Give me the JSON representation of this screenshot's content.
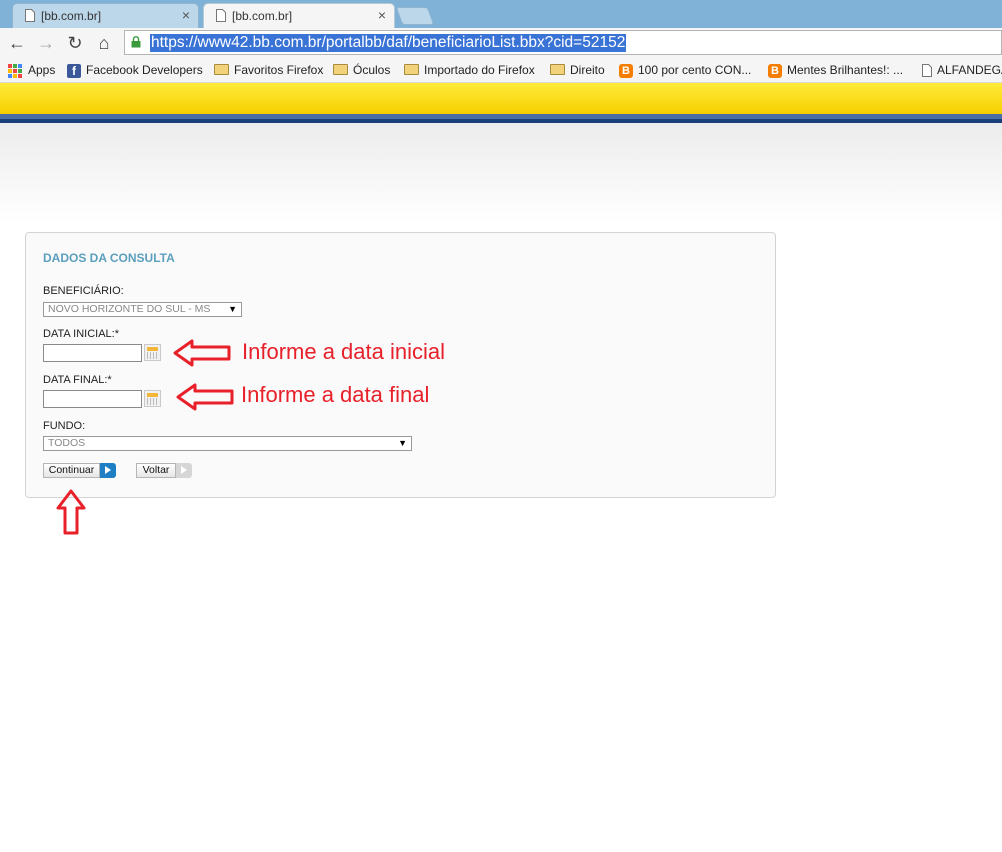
{
  "browser": {
    "tabs": [
      {
        "title": "[bb.com.br]",
        "close": "×",
        "active": false
      },
      {
        "title": "[bb.com.br]",
        "close": "×",
        "active": true
      }
    ],
    "url": "https://www42.bb.com.br/portalbb/daf/beneficiarioList.bbx?cid=52152",
    "nav": {
      "back": "←",
      "forward": "→",
      "reload": "↻",
      "home": "⌂"
    }
  },
  "bookmarks": [
    {
      "label": "Apps",
      "icon": "apps-grid-icon"
    },
    {
      "label": "Facebook Developers",
      "icon": "facebook-icon"
    },
    {
      "label": "Favoritos Firefox",
      "icon": "folder-icon"
    },
    {
      "label": "Óculos",
      "icon": "folder-icon"
    },
    {
      "label": "Importado do Firefox",
      "icon": "folder-icon"
    },
    {
      "label": "Direito",
      "icon": "folder-icon"
    },
    {
      "label": "100 por cento CON...",
      "icon": "blogger-icon"
    },
    {
      "label": "Mentes Brilhantes!: ...",
      "icon": "blogger-icon"
    },
    {
      "label": "ALFANDEGA",
      "icon": "page-icon"
    }
  ],
  "form": {
    "title": "DADOS DA CONSULTA",
    "beneficiario_label": "BENEFICIÁRIO:",
    "beneficiario_value": "NOVO HORIZONTE DO SUL - MS",
    "data_inicial_label": "DATA INICIAL:*",
    "data_inicial_value": "",
    "data_final_label": "DATA FINAL:*",
    "data_final_value": "",
    "fundo_label": "FUNDO:",
    "fundo_value": "TODOS",
    "continuar_label": "Continuar",
    "voltar_label": "Voltar"
  },
  "annotations": {
    "inicial": "Informe a data inicial",
    "final": "Informe a data final"
  },
  "colors": {
    "brand_yellow": "#f6cf00",
    "brand_blue": "#1a3f7a",
    "panel_title": "#5b9fbd",
    "annotation_red": "#e8202a",
    "continuar_accent": "#1e7fc4"
  }
}
